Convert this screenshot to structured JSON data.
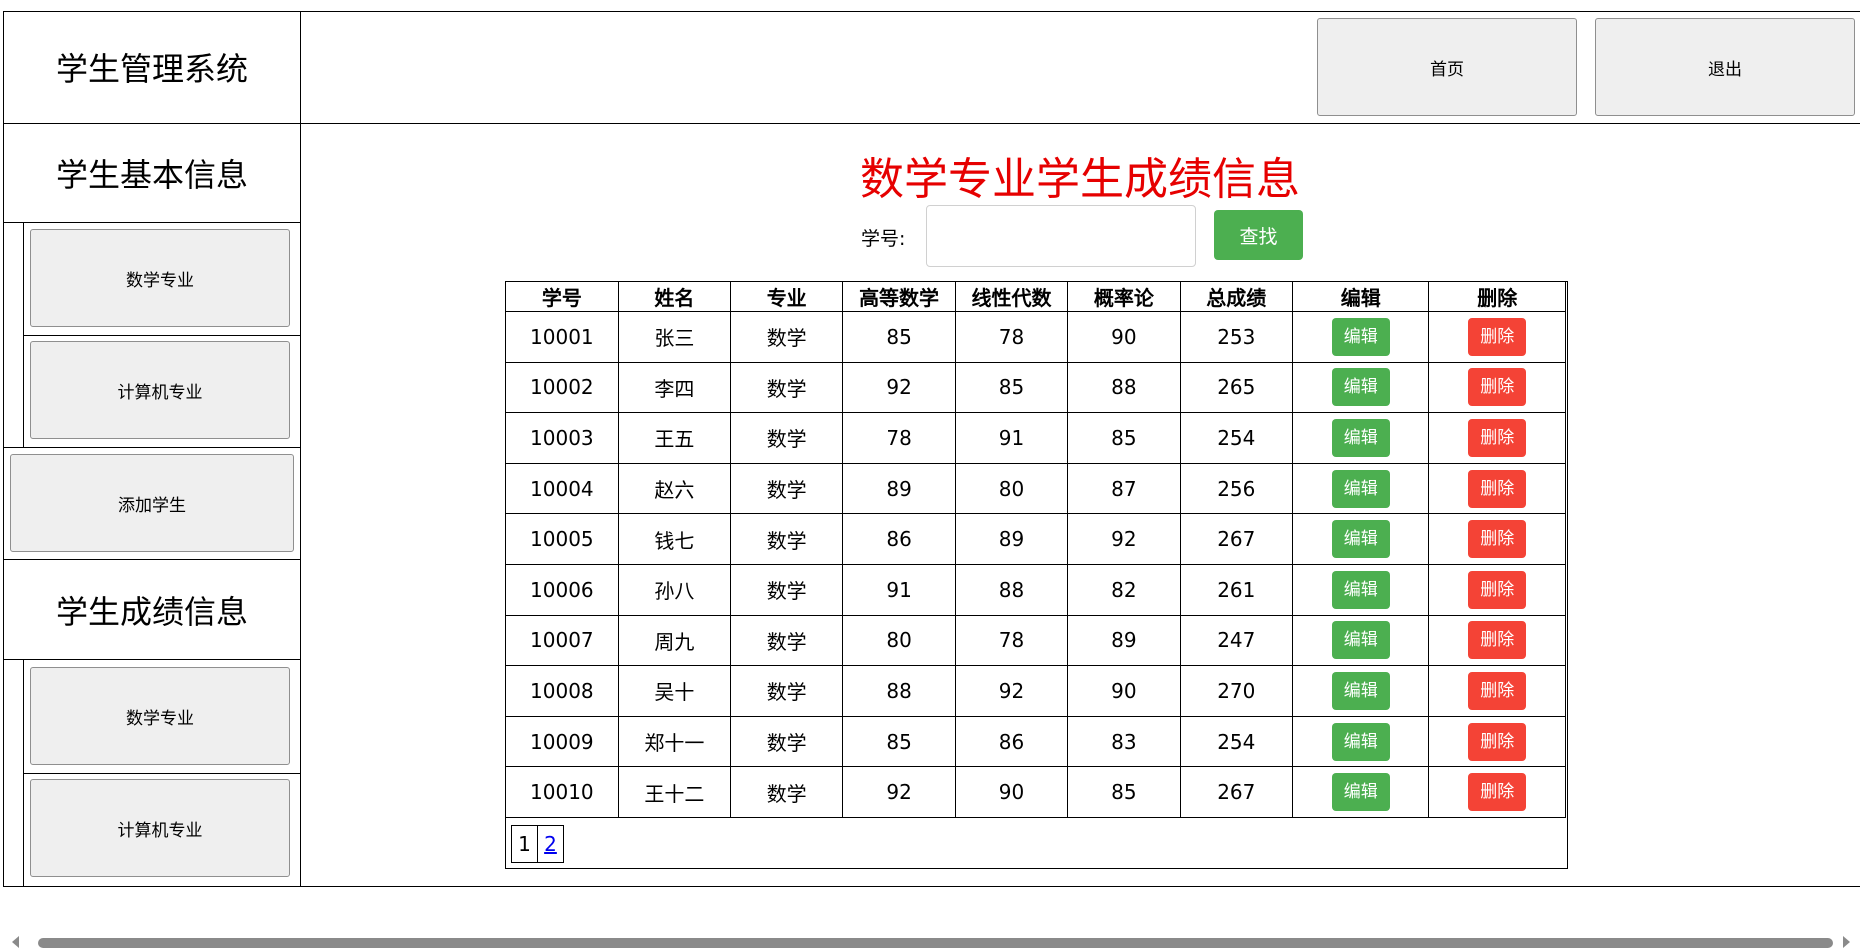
{
  "header": {
    "app_title": "学生管理系统",
    "home_label": "首页",
    "exit_label": "退出"
  },
  "sidebar": {
    "basic_heading": "学生基本信息",
    "basic_items": [
      "数学专业",
      "计算机专业"
    ],
    "add_student_label": "添加学生",
    "score_heading": "学生成绩信息",
    "score_items": [
      "数学专业",
      "计算机专业"
    ]
  },
  "main": {
    "title": "数学专业学生成绩信息",
    "search_label": "学号:",
    "search_value": "",
    "search_button": "查找",
    "columns": [
      "学号",
      "姓名",
      "专业",
      "高等数学",
      "线性代数",
      "概率论",
      "总成绩",
      "编辑",
      "删除"
    ],
    "rows": [
      [
        "10001",
        "张三",
        "数学",
        "85",
        "78",
        "90",
        "253"
      ],
      [
        "10002",
        "李四",
        "数学",
        "92",
        "85",
        "88",
        "265"
      ],
      [
        "10003",
        "王五",
        "数学",
        "78",
        "91",
        "85",
        "254"
      ],
      [
        "10004",
        "赵六",
        "数学",
        "89",
        "80",
        "87",
        "256"
      ],
      [
        "10005",
        "钱七",
        "数学",
        "86",
        "89",
        "92",
        "267"
      ],
      [
        "10006",
        "孙八",
        "数学",
        "91",
        "88",
        "82",
        "261"
      ],
      [
        "10007",
        "周九",
        "数学",
        "80",
        "78",
        "89",
        "247"
      ],
      [
        "10008",
        "吴十",
        "数学",
        "88",
        "92",
        "90",
        "270"
      ],
      [
        "10009",
        "郑十一",
        "数学",
        "85",
        "86",
        "83",
        "254"
      ],
      [
        "10010",
        "王十二",
        "数学",
        "92",
        "90",
        "85",
        "267"
      ]
    ],
    "edit_label": "编辑",
    "delete_label": "删除",
    "pages": [
      "1",
      "2"
    ],
    "current_page": "1"
  },
  "colors": {
    "title_red": "#e60000",
    "edit_green": "#4caf50",
    "delete_red": "#f44336",
    "button_gray": "#efefef"
  }
}
